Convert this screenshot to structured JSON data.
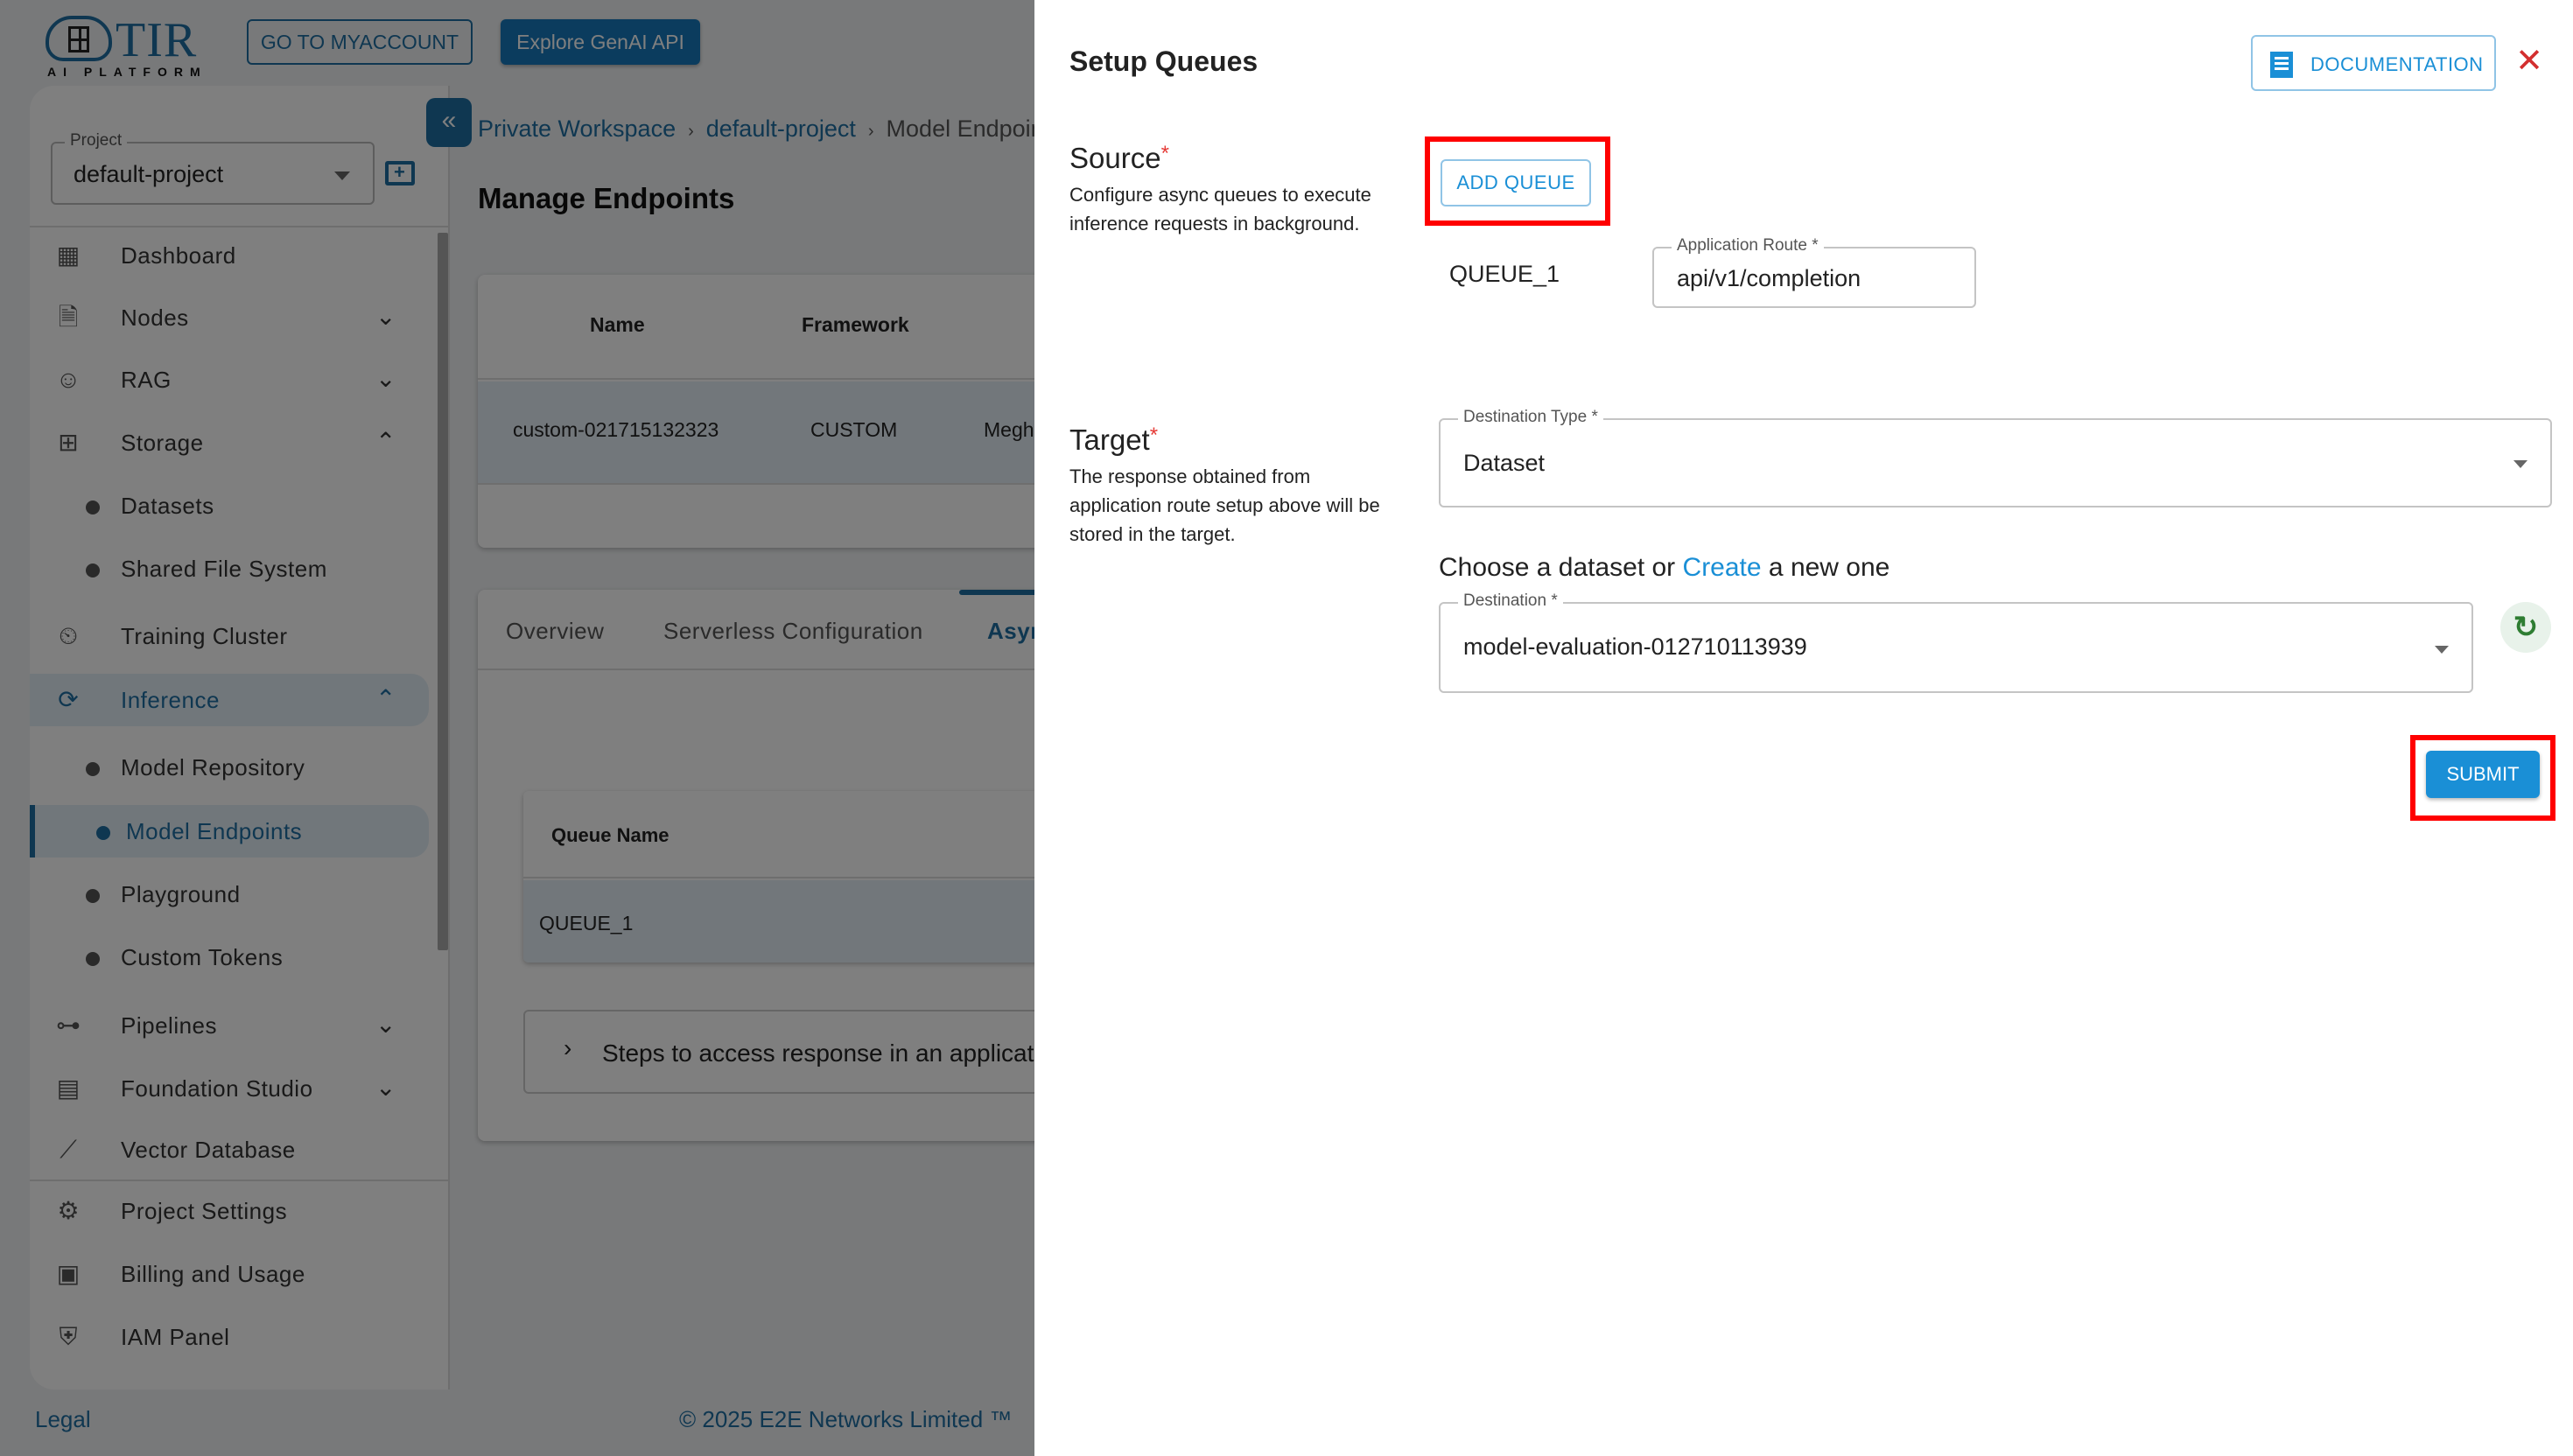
{
  "header": {
    "logo_text": "TIR",
    "logo_subtext": "AI PLATFORM",
    "myaccount_label": "GO TO MYACCOUNT",
    "genai_label": "Explore GenAI API"
  },
  "sidebar": {
    "project_label": "Project",
    "project_value": "default-project",
    "items": [
      {
        "label": "Dashboard",
        "icon": "dashboard-icon"
      },
      {
        "label": "Nodes",
        "icon": "document-icon",
        "chevron": "down"
      },
      {
        "label": "RAG",
        "icon": "robot-icon",
        "chevron": "down"
      },
      {
        "label": "Storage",
        "icon": "storage-icon",
        "chevron": "up"
      },
      {
        "label": "Datasets",
        "sub": true
      },
      {
        "label": "Shared File System",
        "sub": true
      },
      {
        "label": "Training Cluster",
        "icon": "training-cluster-icon"
      },
      {
        "label": "Inference",
        "icon": "inference-icon",
        "chevron": "up",
        "active_parent": true
      },
      {
        "label": "Model Repository",
        "sub": true
      },
      {
        "label": "Model Endpoints",
        "sub": true,
        "active": true
      },
      {
        "label": "Playground",
        "sub": true
      },
      {
        "label": "Custom Tokens",
        "sub": true
      },
      {
        "label": "Pipelines",
        "icon": "pipelines-icon",
        "chevron": "down"
      },
      {
        "label": "Foundation Studio",
        "icon": "foundation-studio-icon",
        "chevron": "down"
      },
      {
        "label": "Vector Database",
        "icon": "vector-database-icon"
      }
    ],
    "bottom_items": [
      {
        "label": "Project Settings",
        "icon": "gear-icon"
      },
      {
        "label": "Billing and Usage",
        "icon": "wallet-icon"
      },
      {
        "label": "IAM Panel",
        "icon": "shield-user-icon"
      }
    ]
  },
  "footer": {
    "legal": "Legal",
    "copyright": "© 2025 E2E Networks Limited ™"
  },
  "main": {
    "breadcrumbs": [
      "Private Workspace",
      "default-project",
      "Model Endpoints"
    ],
    "page_title": "Manage Endpoints",
    "endpoints_table": {
      "columns": [
        "Name",
        "Framework"
      ],
      "rows": [
        {
          "name": "custom-021715132323",
          "framework": "CUSTOM",
          "extra": "Megh"
        }
      ]
    },
    "tabs": [
      "Overview",
      "Serverless Configuration",
      "Async"
    ],
    "selected_tab": "Async",
    "queue_table": {
      "columns": [
        "Queue Name"
      ],
      "rows": [
        "QUEUE_1"
      ]
    },
    "steps_label": "Steps to access response in an application"
  },
  "drawer": {
    "title": "Setup Queues",
    "documentation_label": "DOCUMENTATION",
    "source": {
      "title": "Source",
      "required_mark": "*",
      "description": "Configure async queues to execute inference requests in background.",
      "add_queue_label": "ADD QUEUE",
      "queues": [
        {
          "name": "QUEUE_1",
          "route_label": "Application Route *",
          "route_value": "api/v1/completion"
        }
      ]
    },
    "target": {
      "title": "Target",
      "required_mark": "*",
      "description": "The response obtained from application route setup above will be stored in the target.",
      "destination_type_label": "Destination Type *",
      "destination_type_value": "Dataset",
      "choose_prefix": "Choose a dataset or",
      "choose_link": "Create",
      "choose_suffix": "a new one",
      "destination_label": "Destination *",
      "destination_value": "model-evaluation-012710113939"
    },
    "submit_label": "SUBMIT"
  },
  "colors": {
    "brand": "#1f6fa3",
    "accent": "#1a8fd6",
    "required": "#e53935",
    "highlight": "#ff0000",
    "close": "#d32f2f",
    "refresh": "#2e7d32"
  }
}
